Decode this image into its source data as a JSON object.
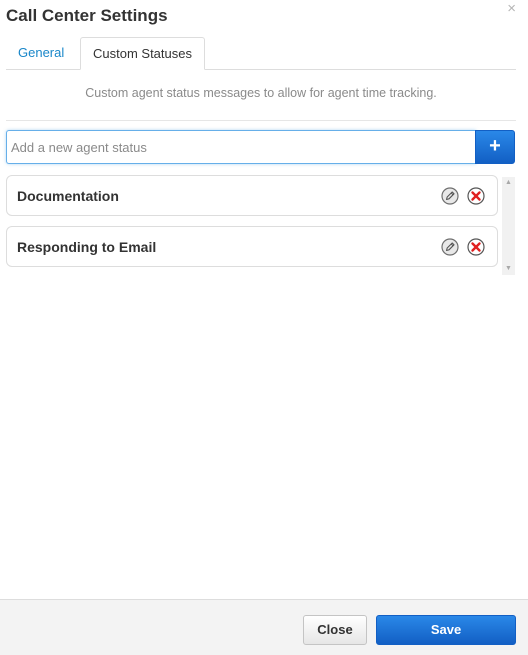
{
  "dialog": {
    "title": "Call Center Settings",
    "close_glyph": "×"
  },
  "tabs": [
    {
      "label": "General",
      "active": false
    },
    {
      "label": "Custom Statuses",
      "active": true
    }
  ],
  "custom_statuses": {
    "description": "Custom agent status messages to allow for agent time tracking.",
    "input_placeholder": "Add a new agent status",
    "input_value": "",
    "add_button_label": "+",
    "items": [
      {
        "label": "Documentation",
        "edit_icon": "pencil-icon",
        "delete_icon": "red-x-icon"
      },
      {
        "label": "Responding to Email",
        "edit_icon": "pencil-icon",
        "delete_icon": "red-x-icon"
      }
    ]
  },
  "footer": {
    "close_label": "Close",
    "save_label": "Save"
  },
  "colors": {
    "accent": "#1a73d9",
    "tab_link": "#1a87c9",
    "delete_red": "#e02020"
  }
}
